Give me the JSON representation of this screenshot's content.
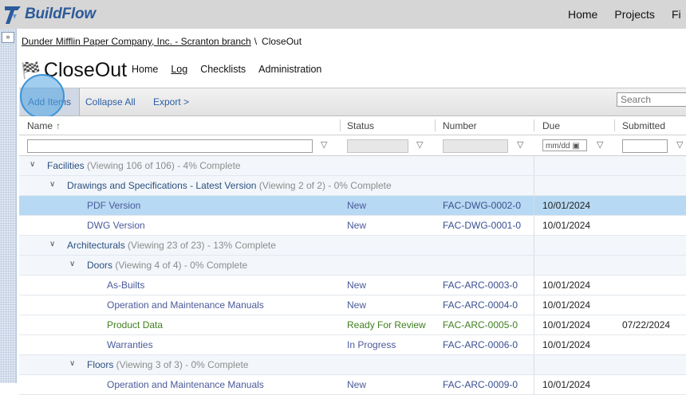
{
  "app": {
    "logo_text": "BuildFlow"
  },
  "topnav": [
    "Home",
    "Projects",
    "Fi"
  ],
  "rail": {
    "toggle": "»"
  },
  "breadcrumb": {
    "company": "Dunder Mifflin Paper Company, Inc. - Scranton branch",
    "separator": "\\",
    "current": "CloseOut"
  },
  "page": {
    "title": "CloseOut",
    "tabs": [
      "Home",
      "Log",
      "Checklists",
      "Administration"
    ],
    "active_tab": "Log"
  },
  "toolbar": {
    "add": "Add Items",
    "collapse": "Collapse All",
    "export": "Export >",
    "search_placeholder": "Search"
  },
  "columns": {
    "name": "Name",
    "sort_indicator": "↑",
    "status": "Status",
    "number": "Number",
    "due": "Due",
    "submitted": "Submitted"
  },
  "filters": {
    "date_placeholder": "mm/dd",
    "filter_icon": "filter-icon"
  },
  "rows": [
    {
      "kind": "group",
      "level": 0,
      "label": "Facilities",
      "meta": "(Viewing 106 of 106) - 4% Complete"
    },
    {
      "kind": "group",
      "level": 1,
      "label": "Drawings and Specifications - Latest Version",
      "meta": "(Viewing 2 of 2) - 0% Complete"
    },
    {
      "kind": "item",
      "level": 2,
      "name": "PDF Version",
      "status": "New",
      "number": "FAC-DWG-0002-0",
      "due": "10/01/2024",
      "submitted": "",
      "selected": true
    },
    {
      "kind": "item",
      "level": 2,
      "name": "DWG Version",
      "status": "New",
      "number": "FAC-DWG-0001-0",
      "due": "10/01/2024",
      "submitted": ""
    },
    {
      "kind": "group",
      "level": 1,
      "label": "Architecturals",
      "meta": "(Viewing 23 of 23) - 13% Complete"
    },
    {
      "kind": "group",
      "level": 2,
      "label": "Doors",
      "meta": "(Viewing 4 of 4) - 0% Complete"
    },
    {
      "kind": "item",
      "level": 3,
      "name": "As-Builts",
      "status": "New",
      "number": "FAC-ARC-0003-0",
      "due": "10/01/2024",
      "submitted": ""
    },
    {
      "kind": "item",
      "level": 3,
      "name": "Operation and Maintenance Manuals",
      "status": "New",
      "number": "FAC-ARC-0004-0",
      "due": "10/01/2024",
      "submitted": ""
    },
    {
      "kind": "item",
      "level": 3,
      "name": "Product Data",
      "status": "Ready For Review",
      "number": "FAC-ARC-0005-0",
      "due": "10/01/2024",
      "submitted": "07/22/2024",
      "tone": "green"
    },
    {
      "kind": "item",
      "level": 3,
      "name": "Warranties",
      "status": "In Progress",
      "number": "FAC-ARC-0006-0",
      "due": "10/01/2024",
      "submitted": ""
    },
    {
      "kind": "group",
      "level": 2,
      "label": "Floors",
      "meta": "(Viewing 3 of 3) - 0% Complete"
    },
    {
      "kind": "item",
      "level": 3,
      "name": "Operation and Maintenance Manuals",
      "status": "New",
      "number": "FAC-ARC-0009-0",
      "due": "10/01/2024",
      "submitted": ""
    }
  ],
  "colors": {
    "topbar": "#d6d6d6",
    "brand": "#2c5a9a",
    "selected_row": "#b7d9f3",
    "group_row": "#f3f7fb",
    "ready_green": "#3f7f1f"
  }
}
